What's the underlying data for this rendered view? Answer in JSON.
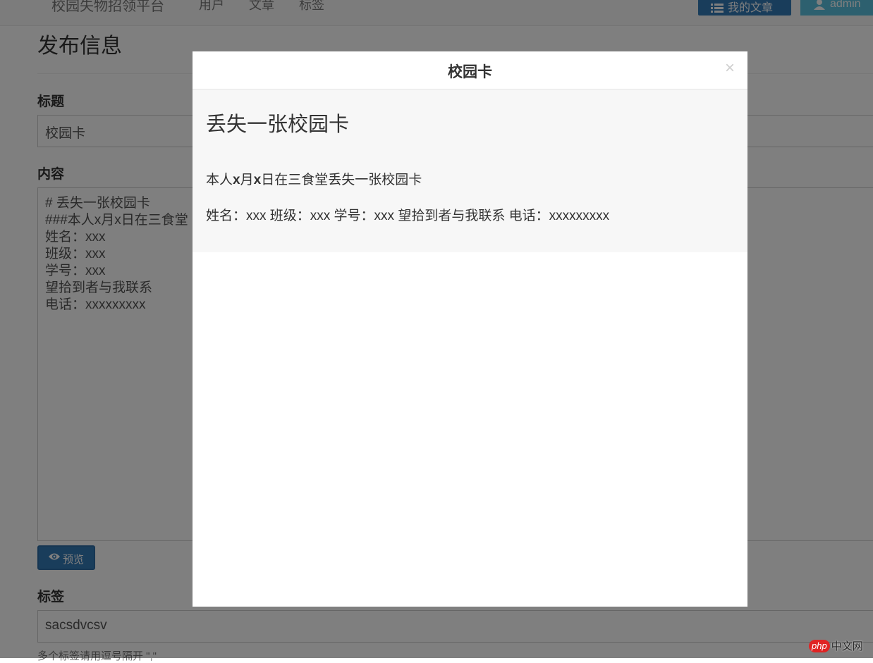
{
  "navbar": {
    "brand": "校园失物招领平台",
    "links": [
      "用户",
      "文章",
      "标签"
    ],
    "my_articles_label": "我的文章",
    "admin_label": "admin"
  },
  "form": {
    "page_title": "发布信息",
    "title_label": "标题",
    "title_value": "校园卡",
    "content_label": "内容",
    "content_lines": [
      "# 丢失一张校园卡",
      "###本人x月x日在三食堂",
      "姓名：xxx",
      "班级：xxx",
      "学号：xxx",
      "望拾到者与我联系",
      "电话：xxxxxxxxx"
    ],
    "preview_button": "预览",
    "tags_label": "标签",
    "tags_value": "sacsdvcsv",
    "tags_help": "多个标签请用逗号隔开 \",\""
  },
  "modal": {
    "title": "校园卡",
    "close_symbol": "×",
    "heading": "丢失一张校园卡",
    "p1_parts": [
      "本人",
      "x",
      "月",
      "x",
      "日在三食堂丢失一张校园卡"
    ],
    "p2": "姓名：xxx 班级：xxx 学号：xxx 望拾到者与我联系 电话：xxxxxxxxx"
  },
  "watermark": {
    "badge": "php",
    "text": "中文网"
  },
  "icons": {
    "list": "list-icon",
    "user": "user-icon",
    "eye": "eye-icon",
    "close": "close-icon"
  },
  "colors": {
    "primary": "#337ab7",
    "info": "#5bc0de",
    "backdrop": "rgba(0,0,0,0.5)"
  }
}
